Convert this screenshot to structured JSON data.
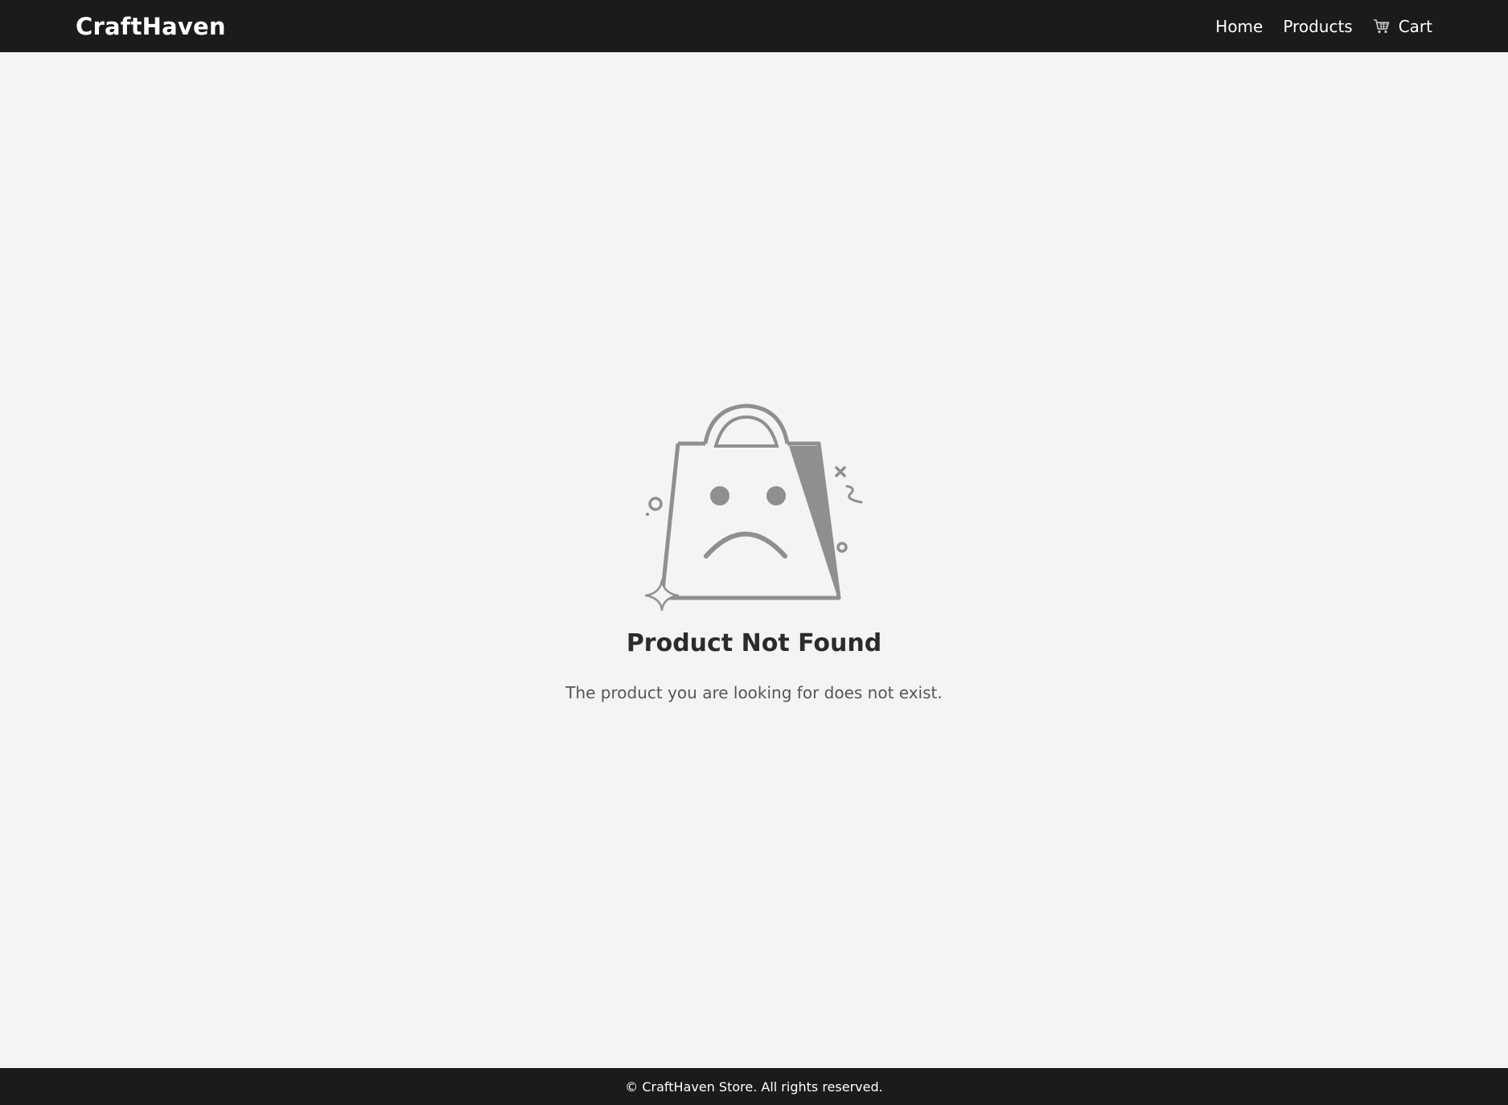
{
  "header": {
    "brand": "CraftHaven",
    "nav": {
      "home": "Home",
      "products": "Products",
      "cart": "Cart",
      "cart_icon": "shopping-cart-icon"
    }
  },
  "main": {
    "illustration_icon": "sad-shopping-bag-icon",
    "title": "Product Not Found",
    "message": "The product you are looking for does not exist."
  },
  "footer": {
    "copyright": "© CraftHaven Store. All rights reserved."
  },
  "colors": {
    "header_bg": "#1b1b1b",
    "page_bg": "#f4f4f4",
    "illustration": "#8f8f8f",
    "title": "#2b2b2b",
    "message": "#555555"
  }
}
